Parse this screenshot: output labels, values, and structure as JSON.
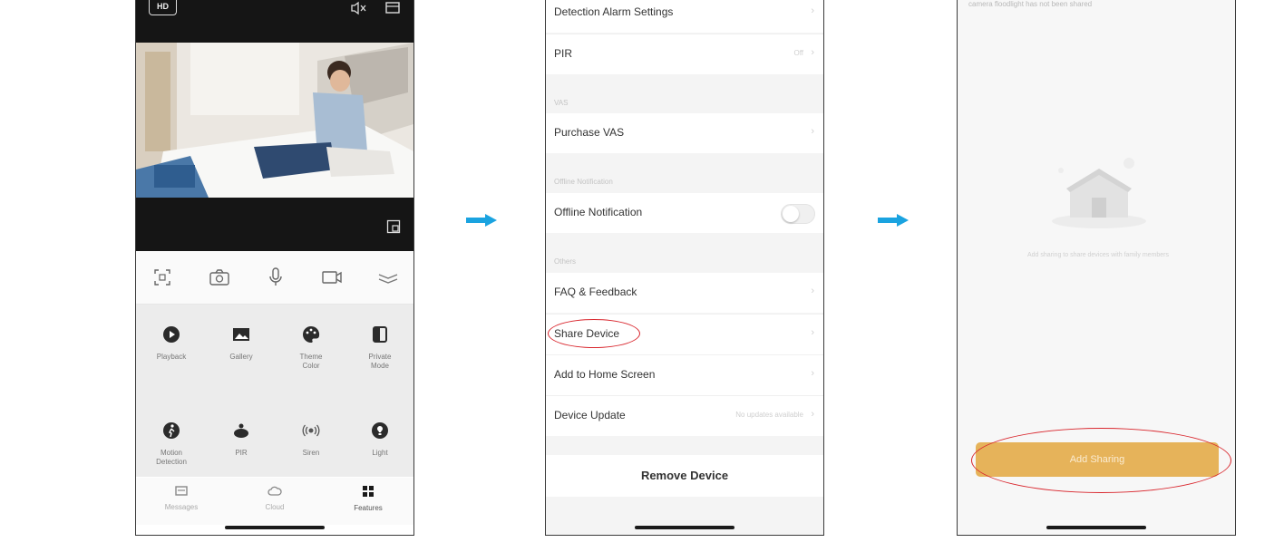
{
  "colors": {
    "accent_arrow": "#1aa3e0",
    "highlight_circle": "#d9272e",
    "add_button": "#e6b35a"
  },
  "phone1": {
    "hd_badge": "HD",
    "icons": [
      "mute-icon",
      "fullscreen-icon",
      "screenshot-icon",
      "scan-icon",
      "camera-icon",
      "microphone-icon",
      "record-icon",
      "collapse-icon"
    ],
    "features": [
      {
        "label": "Playback",
        "icon": "play-icon"
      },
      {
        "label": "Gallery",
        "icon": "gallery-icon"
      },
      {
        "label": "Theme\nColor",
        "icon": "palette-icon"
      },
      {
        "label": "Private\nMode",
        "icon": "private-mode-icon"
      },
      {
        "label": "Motion\nDetection",
        "icon": "motion-icon"
      },
      {
        "label": "PIR",
        "icon": "pir-icon"
      },
      {
        "label": "Siren",
        "icon": "siren-icon"
      },
      {
        "label": "Light",
        "icon": "light-icon"
      }
    ],
    "tabs": [
      {
        "label": "Messages",
        "icon": "messages-icon"
      },
      {
        "label": "Cloud",
        "icon": "cloud-icon"
      },
      {
        "label": "Features",
        "icon": "features-icon"
      }
    ]
  },
  "phone2": {
    "rows": {
      "detection_alarm": "Detection Alarm Settings",
      "pir": "PIR",
      "pir_value": "Off",
      "vas_section": "VAS",
      "purchase_vas": "Purchase VAS",
      "offline_section": "Offline Notification",
      "offline_notification": "Offline Notification",
      "others_section": "Others",
      "faq": "FAQ & Feedback",
      "share_device": "Share Device",
      "add_home": "Add to Home Screen",
      "device_update": "Device Update",
      "device_update_value": "No updates available"
    },
    "remove_device": "Remove Device"
  },
  "phone3": {
    "hint": "camera floodlight has not been shared",
    "empty_text": "Add sharing to share devices with family members",
    "add_sharing": "Add Sharing"
  }
}
